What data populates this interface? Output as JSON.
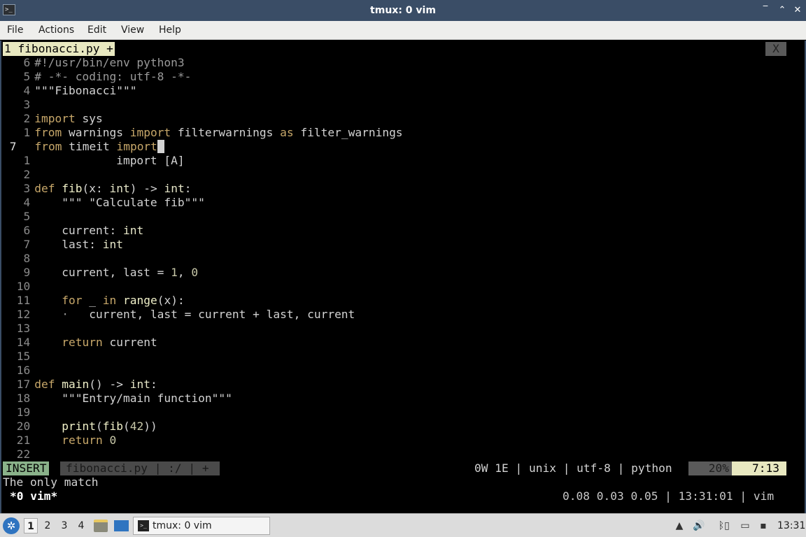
{
  "window": {
    "title": "tmux: 0 vim",
    "buttons": [
      "‾",
      "⌃",
      "✕"
    ]
  },
  "menubar": [
    "File",
    "Actions",
    "Edit",
    "View",
    "Help"
  ],
  "vim": {
    "tab_label": "1 fibonacci.py +",
    "tab_close": "X",
    "lines": [
      {
        "num": "6",
        "current": false,
        "segs": [
          [
            "cm",
            "#!/usr/bin/env python3"
          ]
        ]
      },
      {
        "num": "5",
        "current": false,
        "segs": [
          [
            "cm",
            "# -*- coding: utf-8 -*-"
          ]
        ]
      },
      {
        "num": "4",
        "current": false,
        "segs": [
          [
            "str",
            "\"\"\"Fibonacci\"\"\""
          ]
        ]
      },
      {
        "num": "3",
        "current": false,
        "segs": []
      },
      {
        "num": "2",
        "current": false,
        "segs": [
          [
            "kw",
            "import"
          ],
          [
            "",
            " sys"
          ]
        ]
      },
      {
        "num": "1",
        "current": false,
        "segs": [
          [
            "kw",
            "from"
          ],
          [
            "",
            " warnings "
          ],
          [
            "kw",
            "import"
          ],
          [
            "",
            " filterwarnings "
          ],
          [
            "kw",
            "as"
          ],
          [
            "",
            " filter_warnings"
          ]
        ]
      },
      {
        "num": "7",
        "current": true,
        "segs": [
          [
            "kw",
            "from"
          ],
          [
            "",
            " timeit "
          ],
          [
            "kw",
            "import"
          ],
          [
            "cursor",
            " "
          ]
        ]
      },
      {
        "num": "1",
        "current": false,
        "segs": [
          [
            "",
            "            import [A]"
          ]
        ]
      },
      {
        "num": "2",
        "current": false,
        "segs": []
      },
      {
        "num": "3",
        "current": false,
        "segs": [
          [
            "kw",
            "def"
          ],
          [
            "",
            " "
          ],
          [
            "fn",
            "fib"
          ],
          [
            "",
            "(x: "
          ],
          [
            "ty",
            "int"
          ],
          [
            "",
            ") -> "
          ],
          [
            "ty",
            "int"
          ],
          [
            "",
            ":"
          ]
        ]
      },
      {
        "num": "4",
        "current": false,
        "segs": [
          [
            "str",
            "    \"\"\" \"Calculate fib\"\"\""
          ]
        ]
      },
      {
        "num": "5",
        "current": false,
        "segs": []
      },
      {
        "num": "6",
        "current": false,
        "segs": [
          [
            "",
            "    current: "
          ],
          [
            "ty",
            "int"
          ]
        ]
      },
      {
        "num": "7",
        "current": false,
        "segs": [
          [
            "",
            "    last: "
          ],
          [
            "ty",
            "int"
          ]
        ]
      },
      {
        "num": "8",
        "current": false,
        "segs": []
      },
      {
        "num": "9",
        "current": false,
        "segs": [
          [
            "",
            "    current, last = "
          ],
          [
            "nb",
            "1"
          ],
          [
            "",
            ", "
          ],
          [
            "nb",
            "0"
          ]
        ]
      },
      {
        "num": "10",
        "current": false,
        "segs": []
      },
      {
        "num": "11",
        "current": false,
        "segs": [
          [
            "",
            "    "
          ],
          [
            "kw",
            "for"
          ],
          [
            "",
            " _ "
          ],
          [
            "kw",
            "in"
          ],
          [
            "",
            " "
          ],
          [
            "fn",
            "range"
          ],
          [
            "",
            "(x):"
          ]
        ]
      },
      {
        "num": "12",
        "current": false,
        "segs": [
          [
            "cm",
            "    ·"
          ],
          [
            "",
            "   current, last = current + last, current"
          ]
        ]
      },
      {
        "num": "13",
        "current": false,
        "segs": []
      },
      {
        "num": "14",
        "current": false,
        "segs": [
          [
            "",
            "    "
          ],
          [
            "kw",
            "return"
          ],
          [
            "",
            " current"
          ]
        ]
      },
      {
        "num": "15",
        "current": false,
        "segs": []
      },
      {
        "num": "16",
        "current": false,
        "segs": []
      },
      {
        "num": "17",
        "current": false,
        "segs": [
          [
            "kw",
            "def"
          ],
          [
            "",
            " "
          ],
          [
            "fn",
            "main"
          ],
          [
            "",
            "() -> "
          ],
          [
            "ty",
            "int"
          ],
          [
            "",
            ":"
          ]
        ]
      },
      {
        "num": "18",
        "current": false,
        "segs": [
          [
            "str",
            "    \"\"\"Entry/main function\"\"\""
          ]
        ]
      },
      {
        "num": "19",
        "current": false,
        "segs": []
      },
      {
        "num": "20",
        "current": false,
        "segs": [
          [
            "",
            "    "
          ],
          [
            "fn",
            "print"
          ],
          [
            "",
            "("
          ],
          [
            "fn",
            "fib"
          ],
          [
            "",
            "("
          ],
          [
            "nb",
            "42"
          ],
          [
            "",
            "))"
          ]
        ]
      },
      {
        "num": "21",
        "current": false,
        "segs": [
          [
            "",
            "    "
          ],
          [
            "kw",
            "return"
          ],
          [
            "",
            " "
          ],
          [
            "nb",
            "0"
          ]
        ]
      },
      {
        "num": "22",
        "current": false,
        "segs": []
      }
    ],
    "status": {
      "mode": "INSERT",
      "file": "fibonacci.py | :/ | +",
      "info": "0W 1E | unix | utf-8 | python",
      "percent": "20%",
      "position": "7:13"
    },
    "message": "The only match"
  },
  "tmux": {
    "left": "*0 vim*",
    "right": "0.08 0.03 0.05 | 13:31:01 | vim"
  },
  "taskbar": {
    "workspaces": [
      "1",
      "2",
      "3",
      "4"
    ],
    "active_workspace": "1",
    "task_label": "tmux: 0 vim",
    "clock": "13:31"
  }
}
